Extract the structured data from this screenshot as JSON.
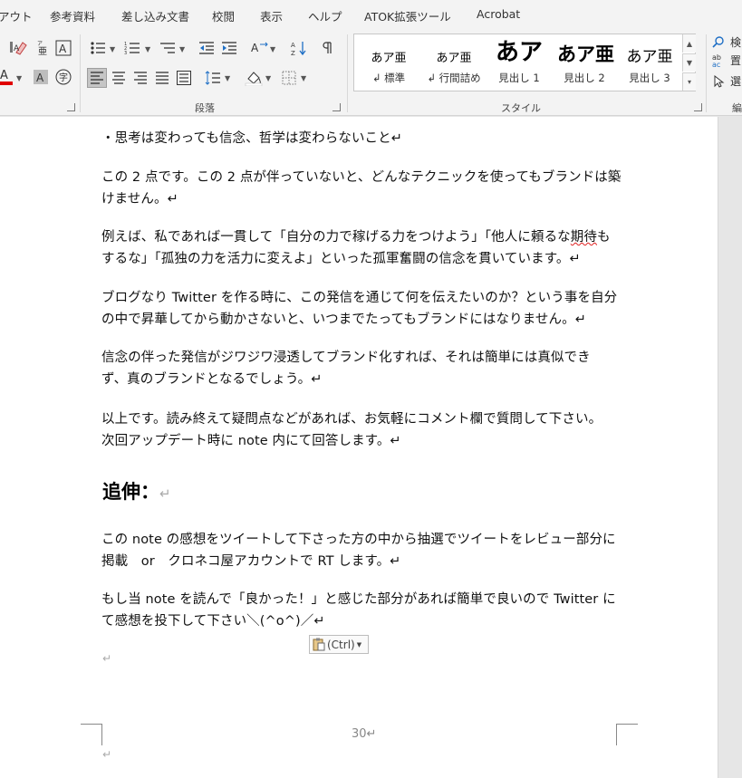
{
  "ribbon_tabs": [
    "アウト",
    "参考資料",
    "差し込み文書",
    "校閲",
    "表示",
    "ヘルプ",
    "ATOK拡張ツール",
    "Acrobat"
  ],
  "groups": {
    "paragraph_label": "段落",
    "styles_label": "スタイル",
    "editing_label": "編"
  },
  "styles": [
    {
      "sample": "あア亜",
      "name": "↲ 標準"
    },
    {
      "sample": "あア亜",
      "name": "↲ 行間詰め"
    },
    {
      "sample": "あア",
      "name": "見出し 1"
    },
    {
      "sample": "あア亜",
      "name": "見出し 2"
    },
    {
      "sample": "あア亜",
      "name": "見出し 3"
    }
  ],
  "editing": {
    "find": "検",
    "replace": "置",
    "select": "選"
  },
  "font_color_accent": "#e00000",
  "document": {
    "para1": [
      "・思考は変わっても信念、哲学は変わらないこと↵"
    ],
    "para2": [
      "この 2 点です。この 2 点が伴っていないと、どんなテクニックを使ってもブランドは築",
      "けません。↵"
    ],
    "para3_line1_before": "例えば、私であれば一貫して「自分の力で稼げる力をつけよう」「他人に頼るな",
    "para3_line1_wavy": "期待",
    "para3_line1_after": "も",
    "para3_line2": "するな」「孤独の力を活力に変えよ」といった孤軍奮闘の信念を貫いています。↵",
    "para4": [
      "ブログなり Twitter を作る時に、この発信を通じて何を伝えたいのか？という事を自分",
      "の中で昇華してから動かさないと、いつまでたってもブランドにはなりません。↵"
    ],
    "para5": [
      "信念の伴った発信がジワジワ浸透してブランド化すれば、それは簡単には真似でき",
      "ず、真のブランドとなるでしょう。↵"
    ],
    "para6": [
      "以上です。読み終えて疑問点などがあれば、お気軽にコメント欄で質問して下さい。",
      "次回アップデート時に note 内にて回答します。↵"
    ],
    "heading": "追伸：",
    "heading_mark": "↵",
    "para7": [
      "この note の感想をツイートして下さった方の中から抽選でツイートをレビュー部分に",
      "掲載　or　クロネコ屋アカウントで RT します。↵"
    ],
    "para8": [
      "もし当 note を読んで「良かった！」と感じた部分があれば簡単で良いので Twitter に",
      "て感想を投下して下さい＼(^o^)／↵"
    ],
    "empty_mark": "↵",
    "paste_options": "(Ctrl)",
    "page_number": "30↵",
    "footer_mark": "↵"
  }
}
